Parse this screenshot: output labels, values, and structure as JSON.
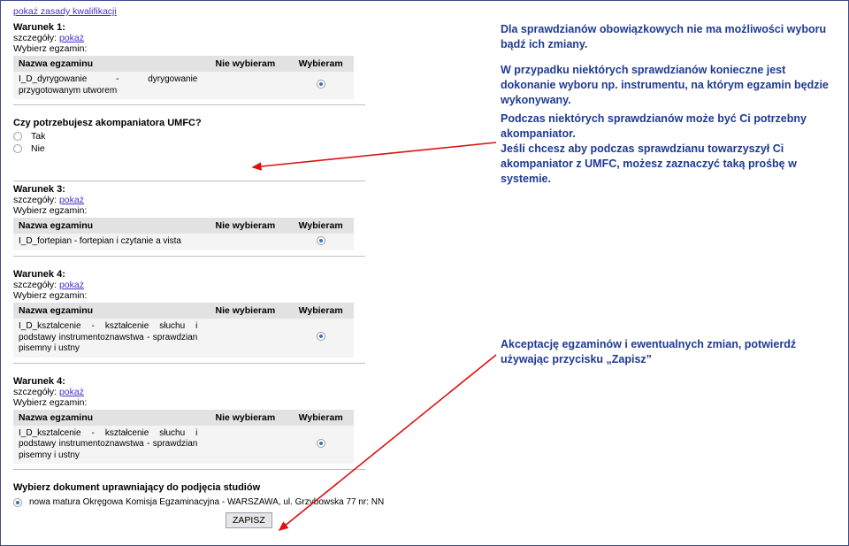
{
  "topLink": "pokaż zasady kwalifikacji",
  "labels": {
    "szczegoly": "szczegóły: ",
    "pokaz": "pokaż",
    "wybierz": "Wybierz egzamin:",
    "nazwa": "Nazwa egzaminu",
    "nieWybieram": "Nie wybieram",
    "wybieram": "Wybieram"
  },
  "blocks": [
    {
      "title": "Warunek 1:",
      "exam": "I_D_dyrygowanie - dyrygowanie przygotowanym utworem",
      "selCol": "wybieram"
    },
    {
      "title": "Warunek 3:",
      "exam": "I_D_fortepian - fortepian i czytanie a vista",
      "selCol": "wybieram"
    },
    {
      "title": "Warunek 4:",
      "exam": "I_D_ksztalcenie - kształcenie słuchu i podstawy instrumentoznawstwa - sprawdzian pisemny i ustny",
      "selCol": "wybieram"
    },
    {
      "title": "Warunek 4:",
      "exam": "I_D_ksztalcenie - kształcenie słuchu i podstawy instrumentoznawstwa - sprawdzian pisemny i ustny",
      "selCol": "wybieram"
    }
  ],
  "akomp": {
    "question": "Czy potrzebujesz akompaniatora UMFC?",
    "opt1": "Tak",
    "opt2": "Nie"
  },
  "doc": {
    "title": "Wybierz dokument uprawniający do podjęcia studiów",
    "text": "nowa matura Okręgowa Komisja Egzaminacyjna - WARSZAWA, ul. Grzybowska 77 nr: NN"
  },
  "zapisz": "ZAPISZ",
  "annot": {
    "a1": "Dla sprawdzianów obowiązkowych nie ma możliwości wyboru bądź ich zmiany.",
    "a2": "W przypadku niektórych sprawdzianów konieczne jest dokonanie wyboru np. instrumentu, na którym egzamin będzie wykonywany.",
    "a3": "Podczas niektórych sprawdzianów może być Ci potrzebny akompaniator.\nJeśli chcesz aby podczas sprawdzianu towarzyszył Ci akompaniator z UMFC, możesz zaznaczyć taką prośbę w systemie.",
    "a4": "Akceptację egzaminów i ewentualnych zmian, potwierdź używając przycisku „Zapisz”"
  }
}
